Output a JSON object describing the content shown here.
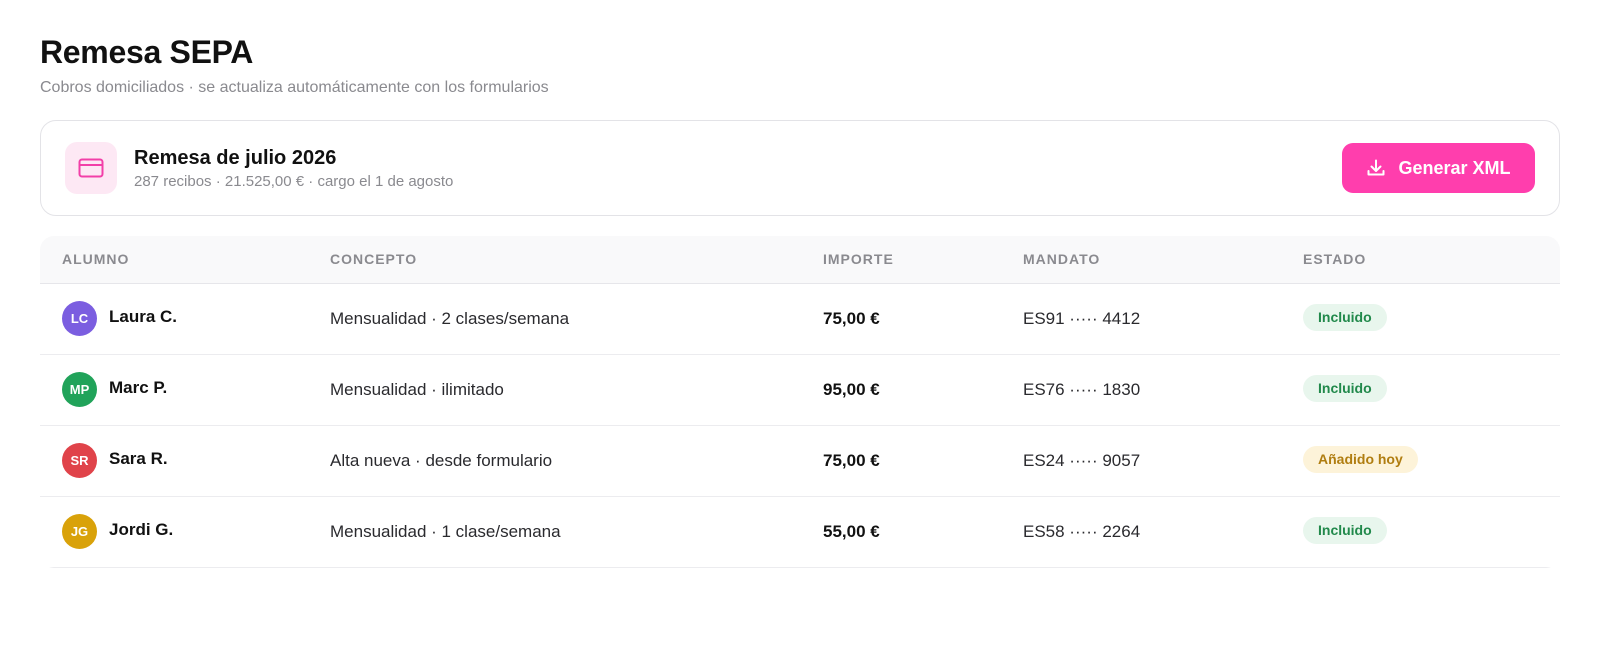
{
  "header": {
    "title": "Remesa SEPA",
    "subtitle": "Cobros domiciliados · se actualiza automáticamente con los formularios"
  },
  "summary": {
    "icon": "credit-card-icon",
    "title": "Remesa de julio 2026",
    "meta": "287 recibos · 21.525,00 € · cargo el 1 de agosto",
    "button_label": "Generar XML",
    "button_icon": "download-icon",
    "accent_color": "#ff3ead"
  },
  "table": {
    "columns": [
      "ALUMNO",
      "CONCEPTO",
      "IMPORTE",
      "MANDATO",
      "ESTADO"
    ],
    "rows": [
      {
        "initials": "LC",
        "avatar_color": "#7b5ee0",
        "name": "Laura C.",
        "concept": "Mensualidad · 2 clases/semana",
        "amount": "75,00 €",
        "mandate": "ES91 ····· 4412",
        "status": "Incluido",
        "status_type": "included"
      },
      {
        "initials": "MP",
        "avatar_color": "#21a35a",
        "name": "Marc P.",
        "concept": "Mensualidad · ilimitado",
        "amount": "95,00 €",
        "mandate": "ES76 ····· 1830",
        "status": "Incluido",
        "status_type": "included"
      },
      {
        "initials": "SR",
        "avatar_color": "#e0434a",
        "name": "Sara R.",
        "concept": "Alta nueva · desde formulario",
        "amount": "75,00 €",
        "mandate": "ES24 ····· 9057",
        "status": "Añadido hoy",
        "status_type": "added"
      },
      {
        "initials": "JG",
        "avatar_color": "#d9a20a",
        "name": "Jordi G.",
        "concept": "Mensualidad · 1 clase/semana",
        "amount": "55,00 €",
        "mandate": "ES58 ····· 2264",
        "status": "Incluido",
        "status_type": "included"
      }
    ]
  },
  "status_colors": {
    "included": {
      "background": "#e8f6ed",
      "text": "#21894b"
    },
    "added": {
      "background": "#fdf3d9",
      "text": "#b07d10"
    }
  }
}
